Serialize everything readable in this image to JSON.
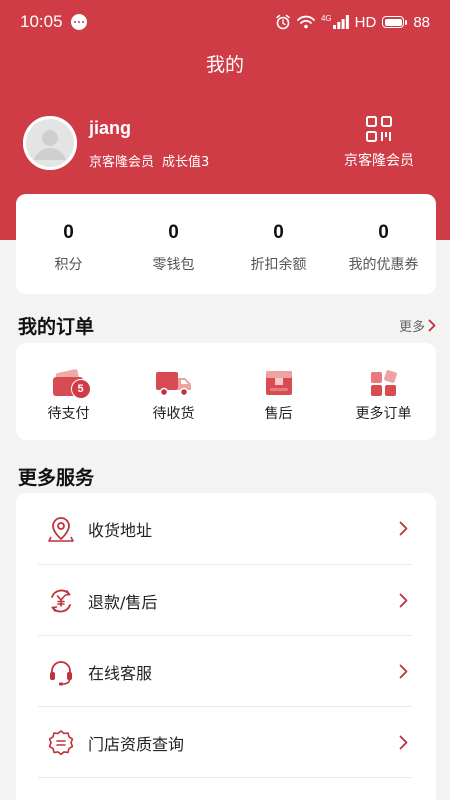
{
  "status_bar": {
    "time": "10:05",
    "network": "4G",
    "hd": "HD",
    "battery": "88"
  },
  "header": {
    "title": "我的"
  },
  "profile": {
    "username": "jiang",
    "member_level": "京客隆会员",
    "growth": "成长值3",
    "qr_label": "京客隆会员"
  },
  "stats": [
    {
      "value": "0",
      "label": "积分"
    },
    {
      "value": "0",
      "label": "零钱包"
    },
    {
      "value": "0",
      "label": "折扣余额"
    },
    {
      "value": "0",
      "label": "我的优惠券"
    }
  ],
  "orders": {
    "title": "我的订单",
    "more": "更多",
    "items": [
      {
        "label": "待支付",
        "icon": "wallet-icon",
        "badge": "5"
      },
      {
        "label": "待收货",
        "icon": "truck-icon"
      },
      {
        "label": "售后",
        "icon": "box-icon"
      },
      {
        "label": "更多订单",
        "icon": "grid-icon"
      }
    ]
  },
  "services": {
    "title": "更多服务",
    "items": [
      {
        "label": "收货地址",
        "icon": "location-pin-icon"
      },
      {
        "label": "退款/售后",
        "icon": "yuan-refund-icon"
      },
      {
        "label": "在线客服",
        "icon": "headset-icon"
      },
      {
        "label": "门店资质查询",
        "icon": "certificate-icon"
      }
    ]
  },
  "colors": {
    "accent": "#d03c46",
    "background": "#f3f3f3",
    "card": "#ffffff"
  }
}
